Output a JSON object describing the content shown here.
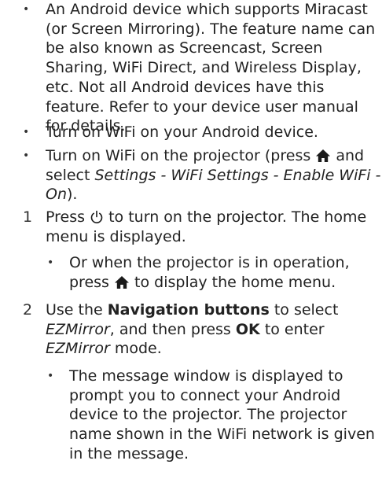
{
  "requirements": [
    {
      "bullet": "•",
      "text": "An Android device which supports Miracast (or Screen Mirroring). The feature name can be also known as Screencast, Screen Sharing, WiFi Direct, and Wireless Display, etc. Not all Android devices have this feature. Refer to your device user manual for details."
    },
    {
      "bullet": "•",
      "text": "Turn on WiFi on your Android device."
    },
    {
      "bullet": "•",
      "parts": {
        "a": "Turn on WiFi on the projector (press",
        "b": "and select",
        "menu_path": "Settings - WiFi Settings - Enable WiFi - On",
        "c": ")."
      }
    }
  ],
  "steps": [
    {
      "number": "1",
      "parts": {
        "a": "Press",
        "b": "to turn on the projector. The home menu is displayed."
      },
      "sub": {
        "bullet": "•",
        "a": "Or when the projector is in operation, press",
        "b": "to display the home menu."
      }
    },
    {
      "number": "2",
      "parts": {
        "a": "Use the",
        "nav_buttons": "Navigation buttons",
        "b": "to select",
        "ezmirror_1": "EZMirror",
        "c": ", and then press",
        "ok": "OK",
        "d": "to enter",
        "ezmirror_2": "EZMirror",
        "e": "mode."
      },
      "sub": {
        "bullet": "•",
        "text": "The message window is displayed to prompt you to connect your Android device to the projector. The projector name shown in the WiFi network is given in the message."
      }
    }
  ],
  "icons": {
    "home": "home-icon",
    "power": "power-icon"
  }
}
